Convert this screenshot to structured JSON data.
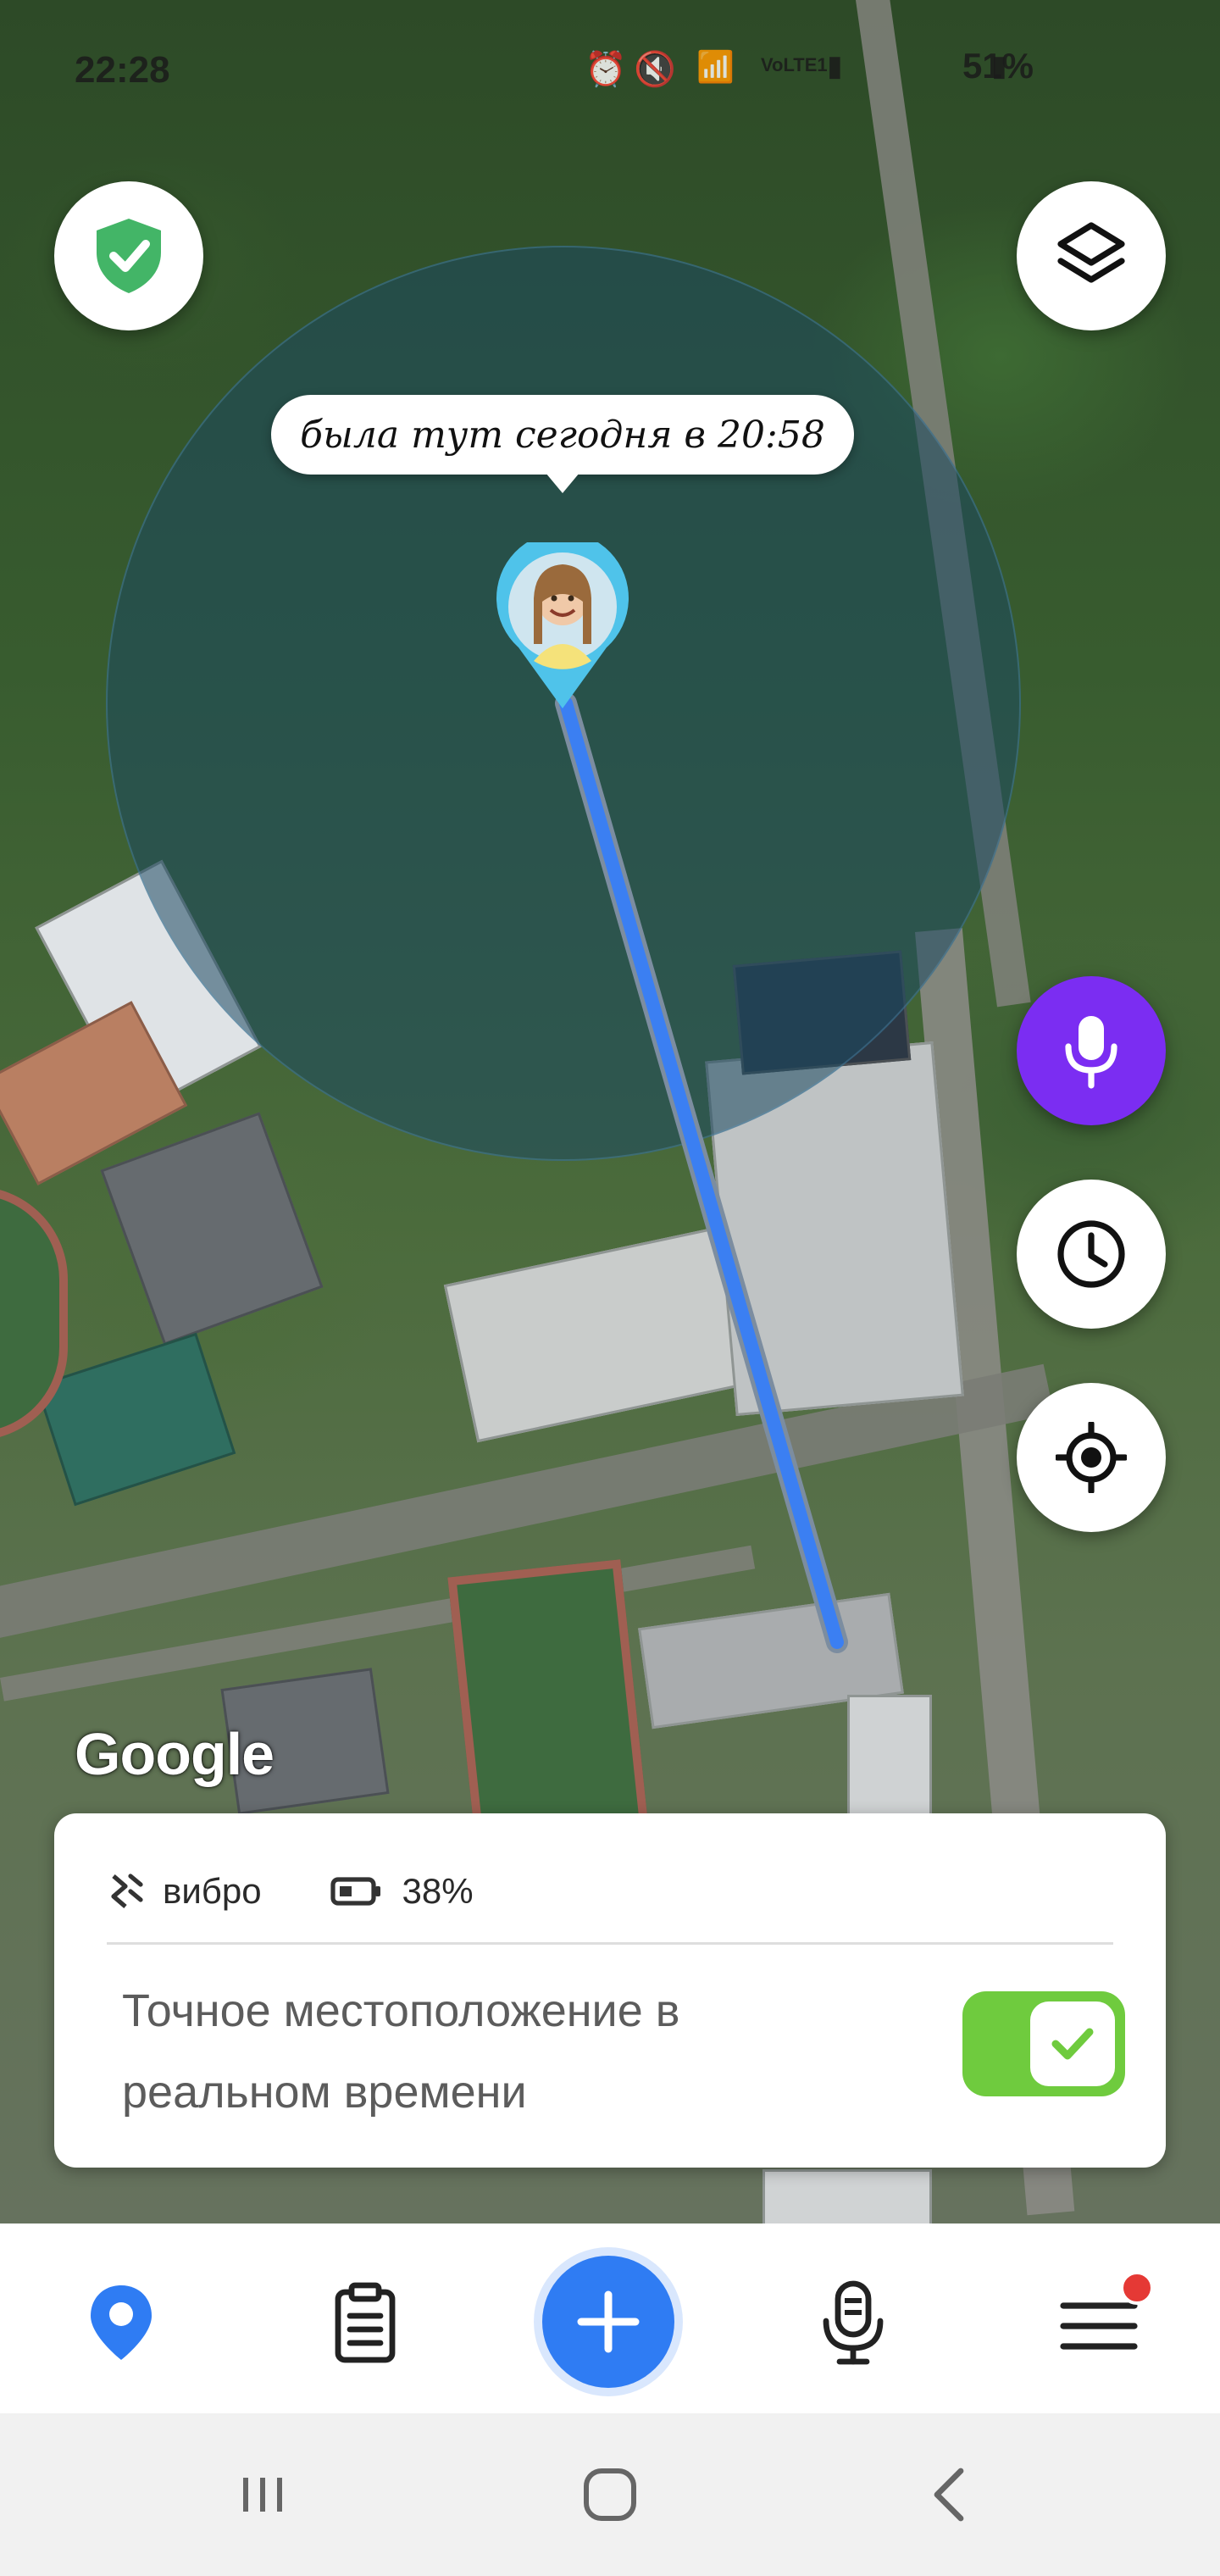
{
  "status_bar": {
    "time": "22:28",
    "battery_percent": "51%",
    "network": "VoLTE1",
    "icons": [
      "alarm-icon",
      "mute-icon",
      "wifi-icon",
      "signal-icon",
      "battery-icon"
    ]
  },
  "map": {
    "bubble_text": "была тут сегодня в 20:58",
    "google_logo": "Google",
    "route_color": "#3b7ff2",
    "accuracy_color": "#1c4860"
  },
  "map_buttons": {
    "safe_zone": {
      "icon": "shield-check-icon",
      "color": "#43b567"
    },
    "layers": {
      "icon": "layers-icon"
    },
    "voice": {
      "icon": "microphone-icon",
      "color": "#7b2df2"
    },
    "history": {
      "icon": "clock-icon"
    },
    "locate": {
      "icon": "crosshair-icon"
    }
  },
  "info_card": {
    "vibro_label": "вибро",
    "battery_level": "38%",
    "realtime_label": "Точное местоположение в реальном времени",
    "realtime_enabled": true,
    "toggle_color": "#6fcb3e"
  },
  "bottom_nav": {
    "items": [
      {
        "icon": "location-pin-icon",
        "active": true
      },
      {
        "icon": "clipboard-icon",
        "active": false
      },
      {
        "icon": "plus-icon",
        "active": false
      },
      {
        "icon": "microphone-outline-icon",
        "active": false
      },
      {
        "icon": "menu-icon",
        "active": false,
        "badge": true
      }
    ],
    "accent": "#2f7cf3",
    "badge_color": "#e53935"
  },
  "system_nav": {
    "items": [
      "recent-apps-icon",
      "home-icon",
      "back-icon"
    ]
  }
}
